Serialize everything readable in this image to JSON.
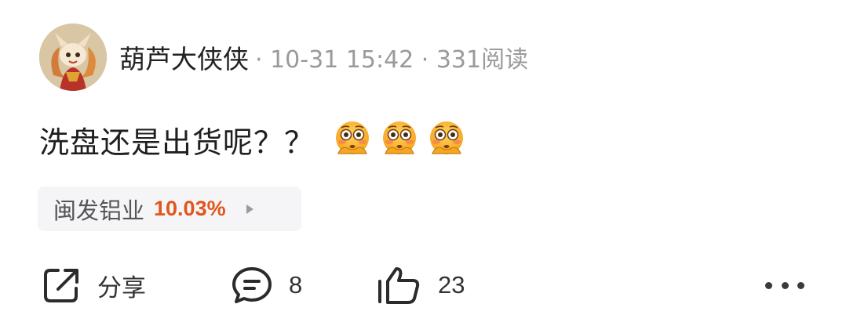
{
  "post": {
    "author": "葫芦大侠侠",
    "meta": " · 10-31 15:42 · 331阅读",
    "body": "洗盘还是出货呢？？",
    "emoji_icon": "flushed-hands-emoji-icon",
    "emoji_count": 3
  },
  "stock": {
    "name": "闽发铝业",
    "change": "10.03%",
    "change_color": "#e0561b"
  },
  "actions": {
    "share": "分享",
    "comments": "8",
    "likes": "23"
  }
}
